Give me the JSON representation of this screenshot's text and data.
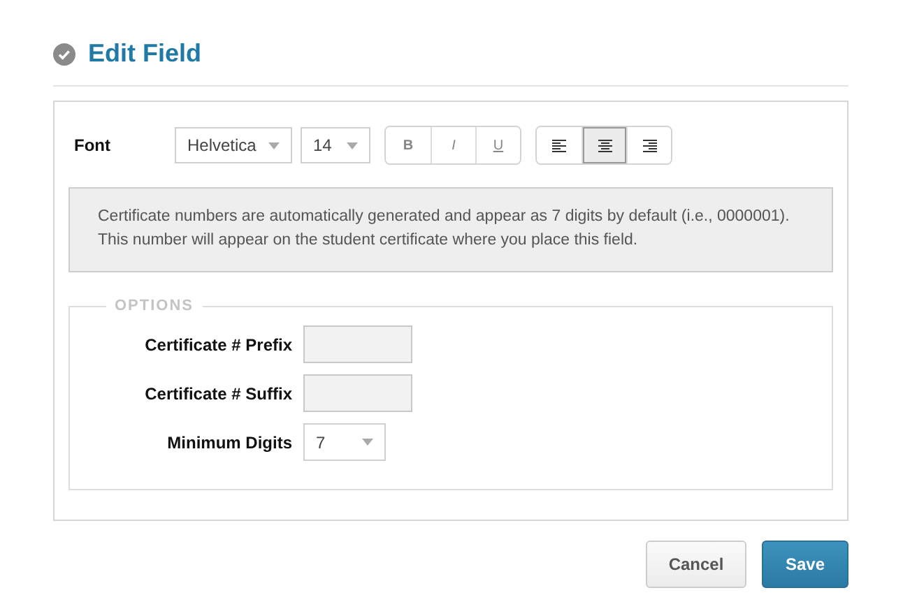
{
  "dialog": {
    "title": "Edit Field"
  },
  "font_row": {
    "label": "Font",
    "font": {
      "value": "Helvetica"
    },
    "size": {
      "value": "14"
    },
    "format_buttons": [
      {
        "label": "B",
        "kind": "bold"
      },
      {
        "label": "I",
        "kind": "italic"
      },
      {
        "label": "U",
        "kind": "underline"
      }
    ],
    "alignment": [
      {
        "kind": "left",
        "selected": false
      },
      {
        "kind": "center",
        "selected": true
      },
      {
        "kind": "right",
        "selected": false
      }
    ]
  },
  "info": "Certificate numbers are automatically generated and appear as 7 digits by default (i.e., 0000001). This number will appear on the student certificate where you place this field.",
  "options": {
    "legend": "OPTIONS",
    "fields": [
      {
        "label": "Certificate # Prefix",
        "kind": "text"
      },
      {
        "label": "Certificate # Suffix",
        "kind": "text"
      },
      {
        "label": "Minimum Digits",
        "kind": "select",
        "value": "7"
      }
    ]
  },
  "buttons": [
    {
      "label": "Cancel",
      "kind": "secondary"
    },
    {
      "label": "Save",
      "kind": "primary"
    }
  ]
}
